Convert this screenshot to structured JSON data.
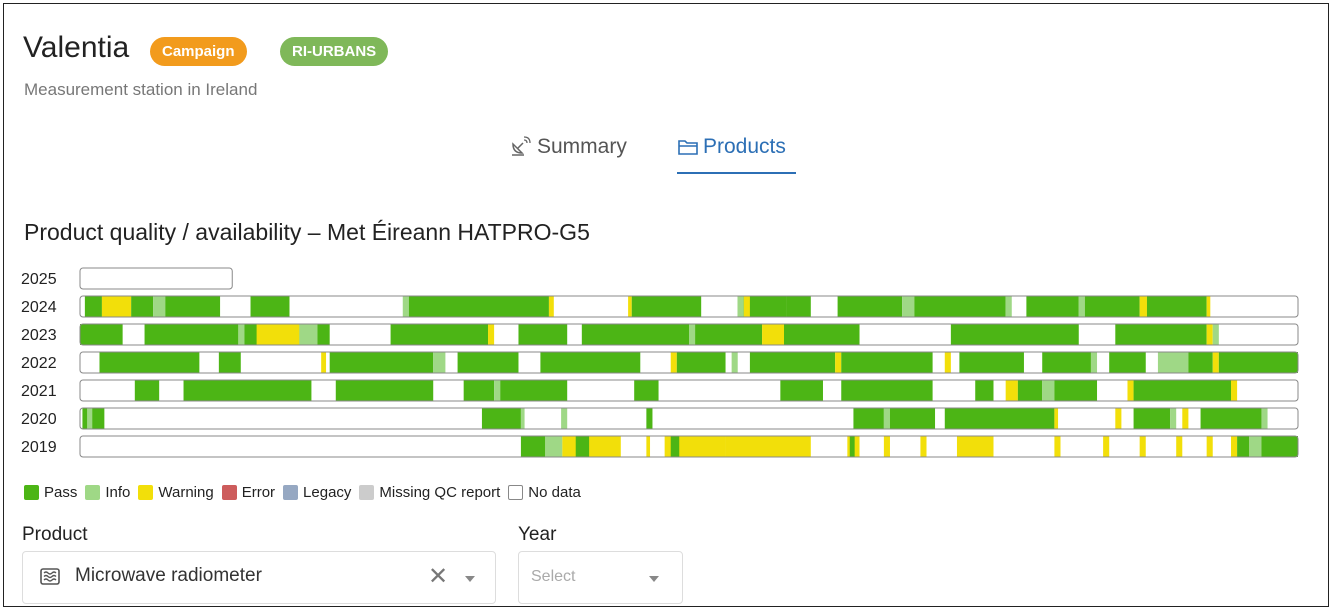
{
  "header": {
    "title": "Valentia",
    "badges": {
      "campaign": "Campaign",
      "network": "RI-URBANS"
    },
    "subtitle": "Measurement station in Ireland"
  },
  "tabs": [
    {
      "label": "Summary",
      "icon": "satellite-dish-icon",
      "active": false
    },
    {
      "label": "Products",
      "icon": "folder-icon",
      "active": true
    }
  ],
  "section": {
    "title": "Product quality / availability – Met Éireann HATPRO-G5"
  },
  "colors": {
    "pass": "#4cb515",
    "info": "#9fd886",
    "warning": "#f2df0a",
    "error": "#cd5c5c",
    "legacy": "#96a8c2",
    "missing": "#cccccc",
    "nodata": "#ffffff",
    "accent": "#2c6fb5",
    "campaign_badge": "#f29b1d",
    "network_badge": "#7fb859"
  },
  "legend": [
    {
      "label": "Pass",
      "key": "pass"
    },
    {
      "label": "Info",
      "key": "info"
    },
    {
      "label": "Warning",
      "key": "warning"
    },
    {
      "label": "Error",
      "key": "error"
    },
    {
      "label": "Legacy",
      "key": "legacy"
    },
    {
      "label": "Missing QC report",
      "key": "missing"
    },
    {
      "label": "No data",
      "key": "nodata"
    }
  ],
  "chart_data": {
    "type": "availability_timeline",
    "x_unit": "fraction of year",
    "years": [
      {
        "year": "2025",
        "coverage": 0.125,
        "segments": []
      },
      {
        "year": "2024",
        "coverage": 1.0,
        "segments": [
          [
            0.004,
            0.018,
            "pass"
          ],
          [
            0.018,
            0.042,
            "warning"
          ],
          [
            0.042,
            0.06,
            "pass"
          ],
          [
            0.06,
            0.07,
            "info"
          ],
          [
            0.07,
            0.115,
            "pass"
          ],
          [
            0.14,
            0.172,
            "pass"
          ],
          [
            0.265,
            0.27,
            "info"
          ],
          [
            0.27,
            0.385,
            "pass"
          ],
          [
            0.385,
            0.389,
            "warning"
          ],
          [
            0.45,
            0.453,
            "warning"
          ],
          [
            0.453,
            0.51,
            "pass"
          ],
          [
            0.54,
            0.58,
            "pass"
          ],
          [
            0.54,
            0.545,
            "info"
          ],
          [
            0.545,
            0.55,
            "warning"
          ],
          [
            0.58,
            0.6,
            "pass"
          ],
          [
            0.622,
            0.675,
            "pass"
          ],
          [
            0.675,
            0.685,
            "info"
          ],
          [
            0.685,
            0.76,
            "pass"
          ],
          [
            0.76,
            0.765,
            "info"
          ],
          [
            0.777,
            0.82,
            "pass"
          ],
          [
            0.82,
            0.825,
            "info"
          ],
          [
            0.825,
            0.87,
            "pass"
          ],
          [
            0.87,
            0.876,
            "warning"
          ],
          [
            0.876,
            0.925,
            "pass"
          ],
          [
            0.925,
            0.928,
            "warning"
          ]
        ]
      },
      {
        "year": "2023",
        "coverage": 1.0,
        "segments": [
          [
            0.0,
            0.035,
            "pass"
          ],
          [
            0.053,
            0.13,
            "pass"
          ],
          [
            0.13,
            0.135,
            "info"
          ],
          [
            0.135,
            0.15,
            "pass"
          ],
          [
            0.145,
            0.2,
            "warning"
          ],
          [
            0.18,
            0.195,
            "info"
          ],
          [
            0.195,
            0.205,
            "pass"
          ],
          [
            0.255,
            0.335,
            "pass"
          ],
          [
            0.335,
            0.34,
            "warning"
          ],
          [
            0.36,
            0.4,
            "pass"
          ],
          [
            0.412,
            0.5,
            "pass"
          ],
          [
            0.5,
            0.505,
            "info"
          ],
          [
            0.505,
            0.56,
            "pass"
          ],
          [
            0.56,
            0.578,
            "warning"
          ],
          [
            0.578,
            0.64,
            "pass"
          ],
          [
            0.715,
            0.82,
            "pass"
          ],
          [
            0.85,
            0.925,
            "pass"
          ],
          [
            0.925,
            0.93,
            "warning"
          ],
          [
            0.93,
            0.935,
            "info"
          ]
        ]
      },
      {
        "year": "2022",
        "coverage": 1.0,
        "segments": [
          [
            0.016,
            0.098,
            "pass"
          ],
          [
            0.114,
            0.132,
            "pass"
          ],
          [
            0.198,
            0.202,
            "warning"
          ],
          [
            0.205,
            0.29,
            "pass"
          ],
          [
            0.29,
            0.3,
            "info"
          ],
          [
            0.31,
            0.36,
            "pass"
          ],
          [
            0.378,
            0.46,
            "pass"
          ],
          [
            0.485,
            0.49,
            "warning"
          ],
          [
            0.49,
            0.53,
            "pass"
          ],
          [
            0.535,
            0.54,
            "info"
          ],
          [
            0.55,
            0.62,
            "pass"
          ],
          [
            0.62,
            0.625,
            "warning"
          ],
          [
            0.625,
            0.7,
            "pass"
          ],
          [
            0.71,
            0.715,
            "warning"
          ],
          [
            0.722,
            0.775,
            "pass"
          ],
          [
            0.79,
            0.83,
            "pass"
          ],
          [
            0.83,
            0.835,
            "info"
          ],
          [
            0.845,
            0.875,
            "pass"
          ],
          [
            0.885,
            0.91,
            "info"
          ],
          [
            0.91,
            0.93,
            "pass"
          ],
          [
            0.93,
            0.935,
            "warning"
          ],
          [
            0.935,
            1.0,
            "pass"
          ]
        ]
      },
      {
        "year": "2021",
        "coverage": 1.0,
        "segments": [
          [
            0.045,
            0.065,
            "pass"
          ],
          [
            0.085,
            0.19,
            "pass"
          ],
          [
            0.21,
            0.29,
            "pass"
          ],
          [
            0.315,
            0.34,
            "pass"
          ],
          [
            0.34,
            0.345,
            "info"
          ],
          [
            0.345,
            0.4,
            "pass"
          ],
          [
            0.455,
            0.475,
            "pass"
          ],
          [
            0.575,
            0.61,
            "pass"
          ],
          [
            0.625,
            0.7,
            "pass"
          ],
          [
            0.735,
            0.75,
            "pass"
          ],
          [
            0.76,
            0.77,
            "warning"
          ],
          [
            0.77,
            0.79,
            "pass"
          ],
          [
            0.79,
            0.8,
            "info"
          ],
          [
            0.8,
            0.835,
            "pass"
          ],
          [
            0.86,
            0.865,
            "warning"
          ],
          [
            0.865,
            0.945,
            "pass"
          ],
          [
            0.945,
            0.95,
            "warning"
          ]
        ]
      },
      {
        "year": "2020",
        "coverage": 1.0,
        "segments": [
          [
            0.002,
            0.006,
            "pass"
          ],
          [
            0.006,
            0.01,
            "info"
          ],
          [
            0.01,
            0.02,
            "pass"
          ],
          [
            0.33,
            0.362,
            "pass"
          ],
          [
            0.362,
            0.365,
            "info"
          ],
          [
            0.395,
            0.4,
            "info"
          ],
          [
            0.465,
            0.47,
            "pass"
          ],
          [
            0.635,
            0.66,
            "pass"
          ],
          [
            0.66,
            0.665,
            "info"
          ],
          [
            0.665,
            0.702,
            "pass"
          ],
          [
            0.71,
            0.8,
            "pass"
          ],
          [
            0.8,
            0.803,
            "warning"
          ],
          [
            0.85,
            0.855,
            "warning"
          ],
          [
            0.865,
            0.895,
            "pass"
          ],
          [
            0.895,
            0.9,
            "info"
          ],
          [
            0.905,
            0.91,
            "warning"
          ],
          [
            0.92,
            0.97,
            "pass"
          ],
          [
            0.97,
            0.975,
            "info"
          ]
        ]
      },
      {
        "year": "2019",
        "coverage": 1.0,
        "segments": [
          [
            0.362,
            0.382,
            "pass"
          ],
          [
            0.382,
            0.396,
            "info"
          ],
          [
            0.396,
            0.444,
            "warning"
          ],
          [
            0.407,
            0.418,
            "pass"
          ],
          [
            0.465,
            0.468,
            "warning"
          ],
          [
            0.48,
            0.53,
            "warning"
          ],
          [
            0.485,
            0.492,
            "pass"
          ],
          [
            0.53,
            0.6,
            "warning"
          ],
          [
            0.63,
            0.64,
            "warning"
          ],
          [
            0.632,
            0.636,
            "pass"
          ],
          [
            0.66,
            0.665,
            "warning"
          ],
          [
            0.69,
            0.695,
            "warning"
          ],
          [
            0.72,
            0.75,
            "warning"
          ],
          [
            0.8,
            0.805,
            "warning"
          ],
          [
            0.84,
            0.845,
            "warning"
          ],
          [
            0.87,
            0.875,
            "warning"
          ],
          [
            0.9,
            0.905,
            "warning"
          ],
          [
            0.925,
            0.93,
            "warning"
          ],
          [
            0.945,
            0.95,
            "warning"
          ],
          [
            0.95,
            0.96,
            "pass"
          ],
          [
            0.96,
            0.97,
            "info"
          ],
          [
            0.97,
            1.0,
            "pass"
          ]
        ]
      }
    ]
  },
  "form": {
    "product": {
      "label": "Product",
      "value": "Microwave radiometer",
      "icon": "radiometer-icon"
    },
    "year": {
      "label": "Year",
      "placeholder": "Select"
    }
  }
}
